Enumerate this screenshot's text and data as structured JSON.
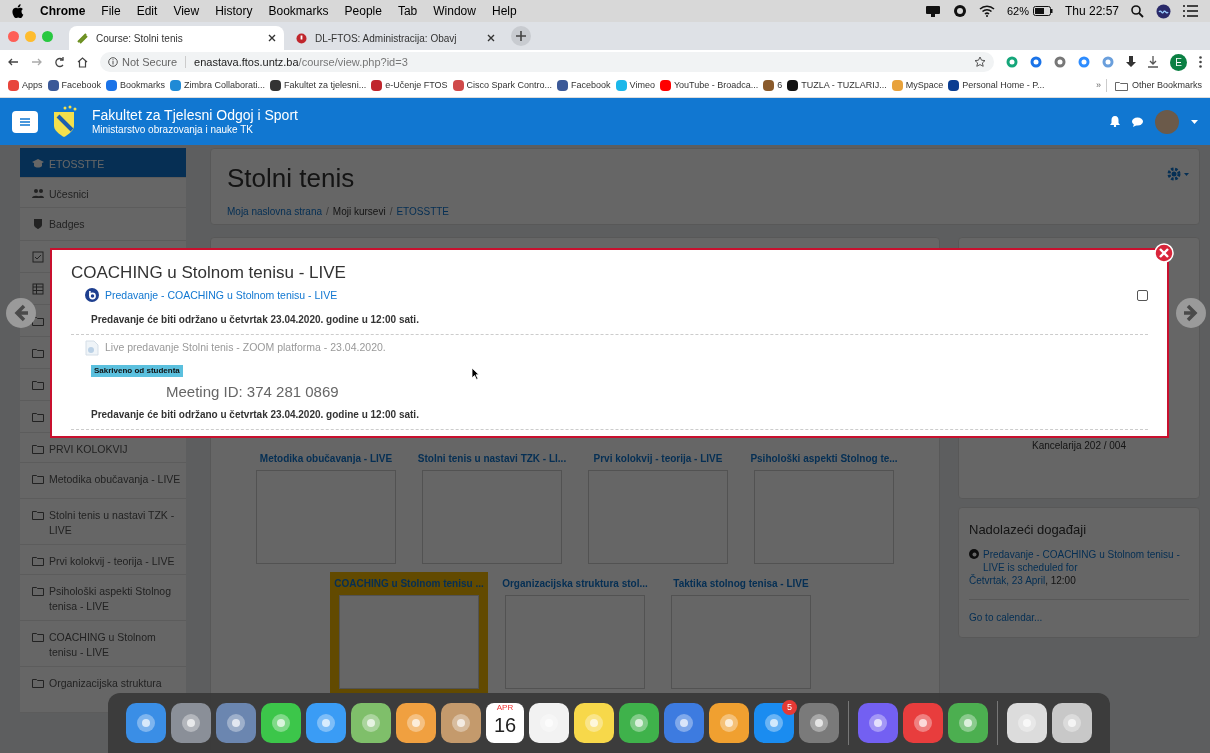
{
  "menubar": {
    "app": "Chrome",
    "menus": [
      "File",
      "Edit",
      "View",
      "History",
      "Bookmarks",
      "People",
      "Tab",
      "Window",
      "Help"
    ],
    "battery": "62%",
    "clock": "Thu 22:57"
  },
  "tabs": [
    {
      "title": "Course: Stolni tenis",
      "selected": true
    },
    {
      "title": "DL-FTOS: Administracija: Obavj",
      "selected": false
    }
  ],
  "address": {
    "security": "Not Secure",
    "host": "enastava.ftos.untz.ba",
    "path": "/course/view.php?id=3",
    "profile": "E"
  },
  "bookmarks": [
    {
      "label": "Apps",
      "color": "#e8453c"
    },
    {
      "label": "Facebook",
      "color": "#3b5998"
    },
    {
      "label": "Bookmarks",
      "color": "#1a73e8"
    },
    {
      "label": "Zimbra Collaborati...",
      "color": "#1f8ad6"
    },
    {
      "label": "Fakultet za tjelesni...",
      "color": "#333333"
    },
    {
      "label": "e-Učenje FTOS",
      "color": "#c0262d"
    },
    {
      "label": "Cisco Spark Contro...",
      "color": "#d04a4a"
    },
    {
      "label": "Facebook",
      "color": "#3b5998"
    },
    {
      "label": "Vimeo",
      "color": "#1ab7ea"
    },
    {
      "label": "YouTube - Broadca...",
      "color": "#ff0000"
    },
    {
      "label": "6",
      "color": "#8a5a2b"
    },
    {
      "label": "TUZLA - TUZLARIJ...",
      "color": "#111111"
    },
    {
      "label": "MySpace",
      "color": "#e8a23c"
    },
    {
      "label": "Personal Home - P...",
      "color": "#0a3d91"
    }
  ],
  "bookmarks_more": "»",
  "other_bookmarks": "Other Bookmarks",
  "site": {
    "title": "Fakultet za Tjelesni Odgoj i Sport",
    "subtitle": "Ministarstvo obrazovanja i nauke TK"
  },
  "sidebar": {
    "items": [
      {
        "label": "ETOSSTTE",
        "kind": "course",
        "selected": true
      },
      {
        "label": "Učesnici",
        "kind": "users",
        "selected": false
      },
      {
        "label": "Badges",
        "kind": "badge",
        "selected": false
      },
      {
        "kind": "check",
        "selected": false
      },
      {
        "kind": "grid",
        "selected": false
      },
      {
        "kind": "folder",
        "selected": false
      },
      {
        "kind": "folder",
        "selected": false
      },
      {
        "kind": "folder",
        "selected": false
      },
      {
        "kind": "folder",
        "selected": false
      },
      {
        "label": "PRVI KOLOKVIJ",
        "kind": "folder",
        "selected": false
      },
      {
        "label": "Metodika obučavanja - LIVE",
        "kind": "folder",
        "selected": false
      },
      {
        "label": "Stolni tenis u nastavi TZK - LIVE",
        "kind": "folder",
        "selected": false
      },
      {
        "label": "Prvi kolokvij - teorija - LIVE",
        "kind": "folder",
        "selected": false
      },
      {
        "label": "Psihološki aspekti Stolnog tenisa - LIVE",
        "kind": "folder",
        "selected": false
      },
      {
        "label": "COACHING u Stolnom tenisu - LIVE",
        "kind": "folder",
        "selected": false
      },
      {
        "label": "Organizacijska struktura",
        "kind": "folder",
        "selected": false
      }
    ]
  },
  "course": {
    "title": "Stolni tenis",
    "breadcrumb": [
      {
        "label": "Moja naslovna strana",
        "link": true
      },
      {
        "label": "Moji kursevi",
        "link": false,
        "separator": "/"
      },
      {
        "label": "ETOSSTTE",
        "link": true,
        "separator": "/"
      }
    ],
    "tile_rows": [
      [
        {
          "title": "Metodika obučavanja - LIVE",
          "selected": false
        },
        {
          "title": "Stolni tenis u nastavi TZK - LI...",
          "selected": false
        },
        {
          "title": "Prvi kolokvij - teorija - LIVE",
          "selected": false
        },
        {
          "title": "Psihološki aspekti Stolnog te...",
          "selected": false
        }
      ],
      [
        {
          "title": "COACHING u Stolnom tenisu ...",
          "selected": true
        },
        {
          "title": "Organizacijska struktura stol...",
          "selected": false
        },
        {
          "title": "Taktika stolnog tenisa - LIVE",
          "selected": false
        }
      ]
    ]
  },
  "contact": {
    "office": "Kancelarija 202 / 004"
  },
  "events": {
    "title": "Nadolazeći događaji",
    "event": "Predavanje - COACHING u Stolnom tenisu - LIVE is scheduled for",
    "date": "Četvrtak, 23 April",
    "time": ", 12:00",
    "calendar_link": "Go to calendar..."
  },
  "modal": {
    "title": "COACHING u Stolnom tenisu - LIVE",
    "activities": [
      {
        "kind": "conference",
        "name": "Predavanje - COACHING u Stolnom tenisu - LIVE",
        "hidden": false,
        "completion_checked": false,
        "description": "Predavanje će biti održano u četvrtak 23.04.2020. godine u 12:00 sati."
      },
      {
        "kind": "file",
        "name": "Live predavanje Stolni tenis - ZOOM platforma - 23.04.2020.",
        "hidden": true,
        "badge": "Sakriveno od studenta",
        "meeting_id": "Meeting ID: 374 281 0869",
        "description": "Predavanje će biti održano u četvrtak 23.04.2020. godine u 12:00 sati."
      }
    ]
  },
  "dock": [
    {
      "kind": "app",
      "color": "#3a8ee6"
    },
    {
      "kind": "app",
      "color": "#8a8f98"
    },
    {
      "kind": "app",
      "color": "#6b86b0"
    },
    {
      "kind": "app",
      "color": "#3cc64a"
    },
    {
      "kind": "app",
      "color": "#3a9cf5"
    },
    {
      "kind": "app",
      "color": "#7fbf6a"
    },
    {
      "kind": "app",
      "color": "#f0a040"
    },
    {
      "kind": "app",
      "color": "#c49a6c"
    },
    {
      "kind": "calendar",
      "month": "APR",
      "day": "16"
    },
    {
      "kind": "app",
      "color": "#f2f2f2"
    },
    {
      "kind": "app",
      "color": "#f7d84a"
    },
    {
      "kind": "app",
      "color": "#3fb24b"
    },
    {
      "kind": "app",
      "color": "#3d7be0"
    },
    {
      "kind": "app",
      "color": "#f0a030"
    },
    {
      "kind": "app",
      "color": "#1a8cf0",
      "badge": "5"
    },
    {
      "kind": "app",
      "color": "#7a7a7a"
    },
    {
      "kind": "separator"
    },
    {
      "kind": "app",
      "color": "#7360f2"
    },
    {
      "kind": "app",
      "color": "#e83d3d"
    },
    {
      "kind": "app",
      "color": "#4caf50"
    },
    {
      "kind": "separator"
    },
    {
      "kind": "app",
      "color": "#dcdcdc"
    },
    {
      "kind": "app",
      "color": "#c8c8c8"
    }
  ]
}
